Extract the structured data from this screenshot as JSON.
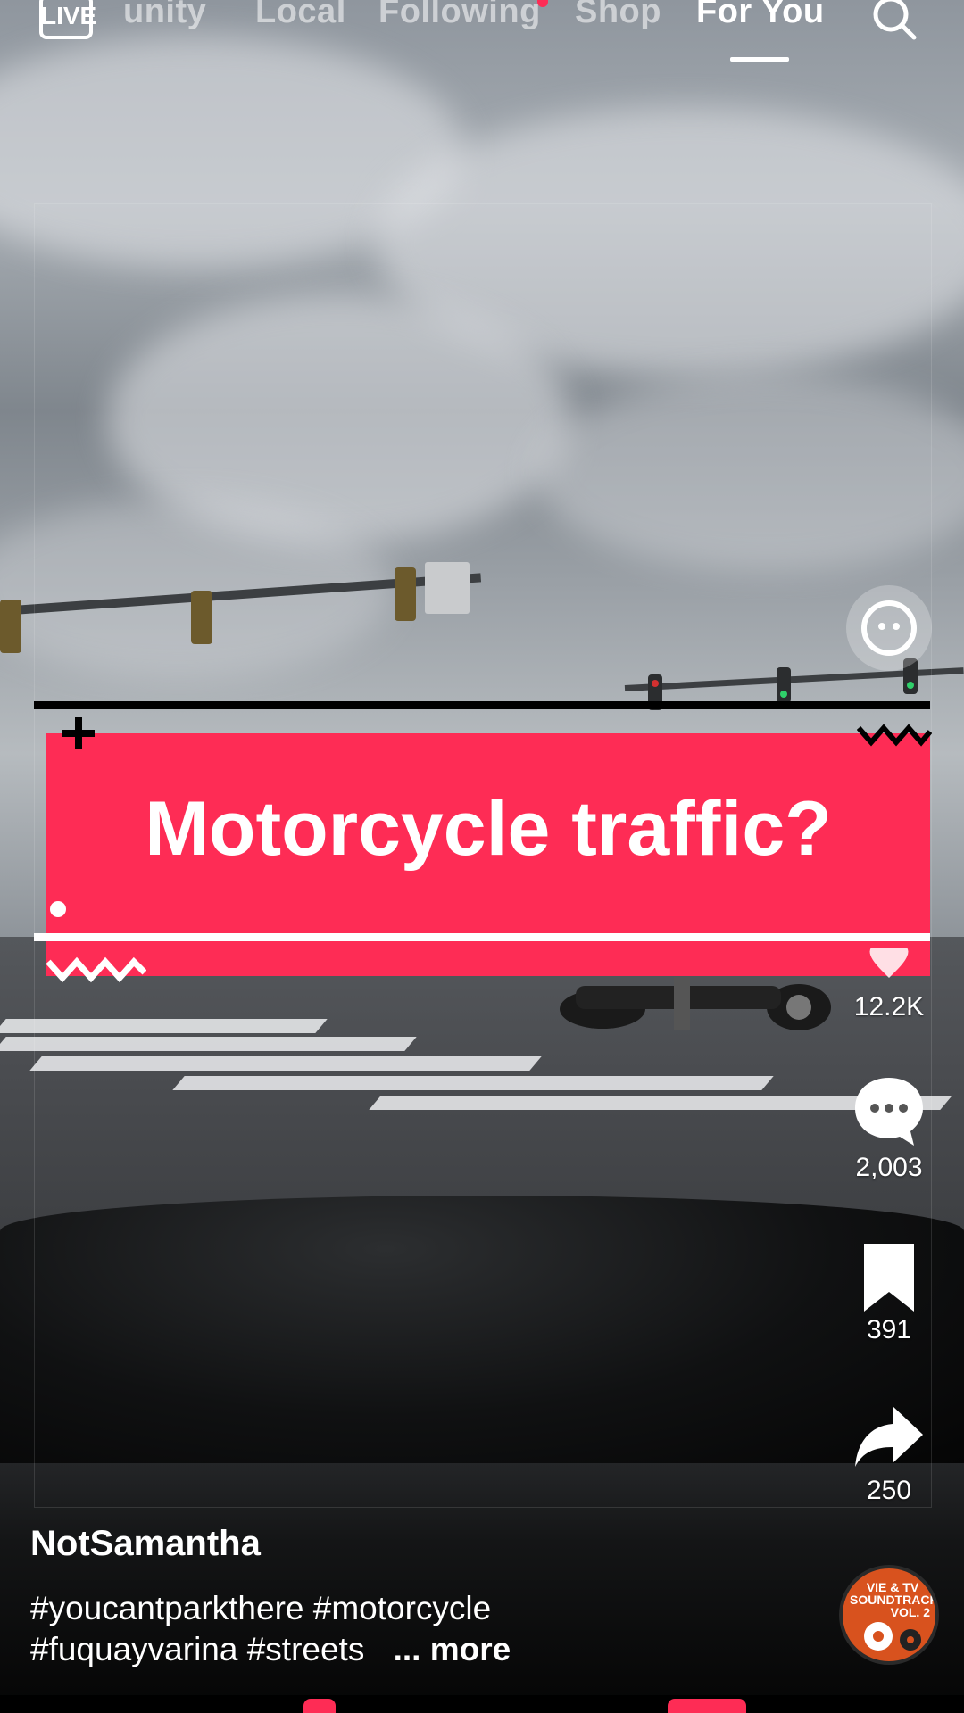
{
  "top_nav": {
    "live_label": "LIVE",
    "items": [
      {
        "label": "unity",
        "active": false
      },
      {
        "label": "Local",
        "active": false
      },
      {
        "label": "Following",
        "active": false,
        "has_notification_dot": true
      },
      {
        "label": "Shop",
        "active": false
      },
      {
        "label": "For You",
        "active": true
      }
    ],
    "search_icon": "search-icon"
  },
  "video": {
    "overlay_title": "Motorcycle traffic?",
    "overlay_color": "#fe2c55"
  },
  "actions": {
    "like_count": "12.2K",
    "comment_count": "2,003",
    "save_count": "391",
    "share_count": "250",
    "icons": [
      "ai-assistant-icon",
      "heart-icon",
      "comment-icon",
      "bookmark-icon",
      "share-icon",
      "music-disc-icon"
    ]
  },
  "post": {
    "username": "NotSamantha",
    "hashtags_line1": "#youcantparkthere  #motorcycle",
    "hashtags_line2": "#fuquayvarina  #streets",
    "more_label": "... more"
  },
  "music_disc": {
    "line1": "VIE & TV",
    "line2": "SOUNDTRACKS",
    "line3": "VOL. 2"
  },
  "colors": {
    "accent": "#fe2c55",
    "text": "#ffffff",
    "inactive_tab": "rgba(255,255,255,0.55)"
  }
}
